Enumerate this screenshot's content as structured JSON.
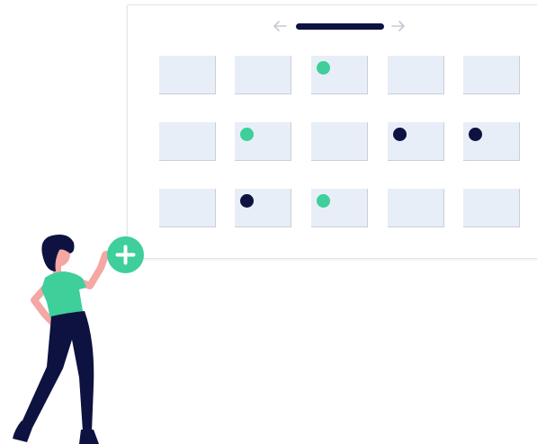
{
  "illustration": {
    "colors": {
      "accent": "#3ecf9a",
      "navy": "#0d1241",
      "cell": "#e8eef7",
      "cell_border": "#c9ced8",
      "skin": "#f4a7a3",
      "hair": "#0d1241",
      "shirt": "#3ecf9a",
      "pants": "#0d1241"
    },
    "icons": {
      "prev": "arrow-left-icon",
      "next": "arrow-right-icon",
      "add": "plus-icon"
    },
    "calendar": {
      "rows": [
        [
          "none",
          "none",
          "green",
          "none",
          "none"
        ],
        [
          "none",
          "green",
          "none",
          "navy",
          "navy"
        ],
        [
          "none",
          "navy",
          "green",
          "none",
          "none"
        ]
      ]
    }
  }
}
